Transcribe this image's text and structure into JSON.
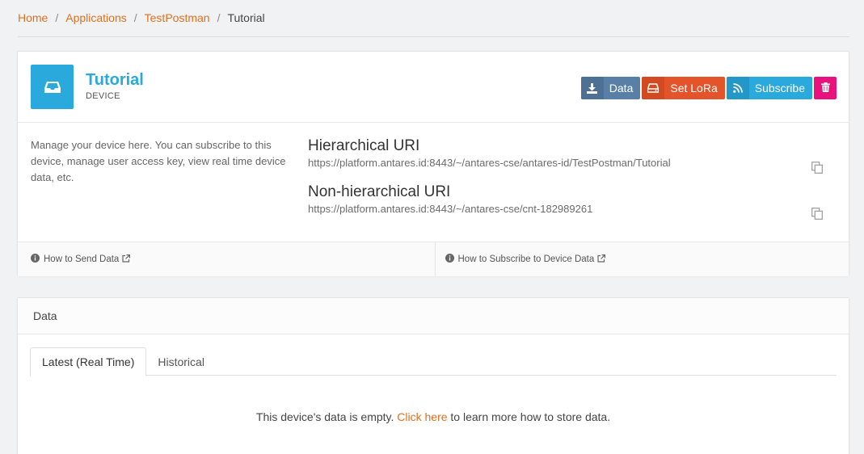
{
  "breadcrumb": {
    "home": "Home",
    "applications": "Applications",
    "app": "TestPostman",
    "current": "Tutorial",
    "separator": "/"
  },
  "device": {
    "name": "Tutorial",
    "type": "DEVICE",
    "icon": "inbox-icon",
    "accent_color": "#29a9dc"
  },
  "actions": {
    "data_label": "Data",
    "lora_label": "Set LoRa",
    "subscribe_label": "Subscribe",
    "colors": {
      "data": "#5a7fa6",
      "lora": "#e3542b",
      "subscribe": "#29a9dc",
      "delete": "#e8127f"
    }
  },
  "description": "Manage your device here. You can subscribe to this device, manage user access key, view real time device data, etc.",
  "uris": {
    "hierarchical": {
      "title": "Hierarchical URI",
      "value": "https://platform.antares.id:8443/~/antares-cse/antares-id/TestPostman/Tutorial"
    },
    "non_hierarchical": {
      "title": "Non-hierarchical URI",
      "value": "https://platform.antares.id:8443/~/antares-cse/cnt-182989261"
    }
  },
  "help_links": {
    "send": "How to Send Data",
    "subscribe": "How to Subscribe to Device Data"
  },
  "data_panel": {
    "title": "Data",
    "tabs": [
      "Latest (Real Time)",
      "Historical"
    ],
    "active_tab": "Latest (Real Time)",
    "empty_prefix": "This device's data is empty.",
    "empty_link": "Click here",
    "empty_suffix": "to learn more how to store data."
  }
}
